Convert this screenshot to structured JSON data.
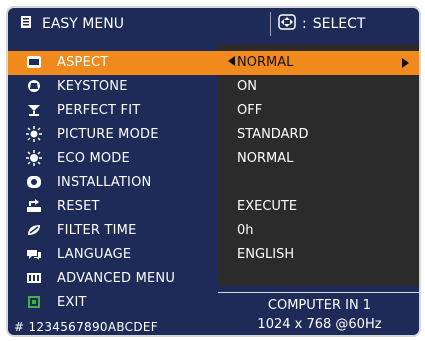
{
  "header": {
    "title": "EASY MENU",
    "select_label": "SELECT",
    "select_icon": "dpad-icon"
  },
  "menu": [
    {
      "label": "ASPECT",
      "value": "NORMAL",
      "icon": "aspect-icon",
      "selected": true
    },
    {
      "label": "KEYSTONE",
      "value": "ON",
      "icon": "keystone-icon"
    },
    {
      "label": "PERFECT FIT",
      "value": "OFF",
      "icon": "perfect-fit-icon"
    },
    {
      "label": "PICTURE MODE",
      "value": "STANDARD",
      "icon": "picture-mode-icon"
    },
    {
      "label": "ECO MODE",
      "value": "NORMAL",
      "icon": "eco-mode-icon"
    },
    {
      "label": "INSTALLATION",
      "value": "",
      "icon": "installation-icon"
    },
    {
      "label": "RESET",
      "value": "EXECUTE",
      "icon": "reset-icon"
    },
    {
      "label": "FILTER TIME",
      "value": "0h",
      "icon": "filter-time-icon"
    },
    {
      "label": "LANGUAGE",
      "value": "ENGLISH",
      "icon": "language-icon"
    },
    {
      "label": "ADVANCED MENU",
      "value": "",
      "icon": "advanced-menu-icon"
    },
    {
      "label": "EXIT",
      "value": "",
      "icon": "exit-icon"
    }
  ],
  "info": {
    "line1": "COMPUTER IN 1",
    "line2": "1024 x 768 @60Hz"
  },
  "serial": "# 1234567890ABCDEF",
  "colors": {
    "background": "#1e2a57",
    "selected": "#f18a1c",
    "value_panel": "#2b2b2b"
  }
}
